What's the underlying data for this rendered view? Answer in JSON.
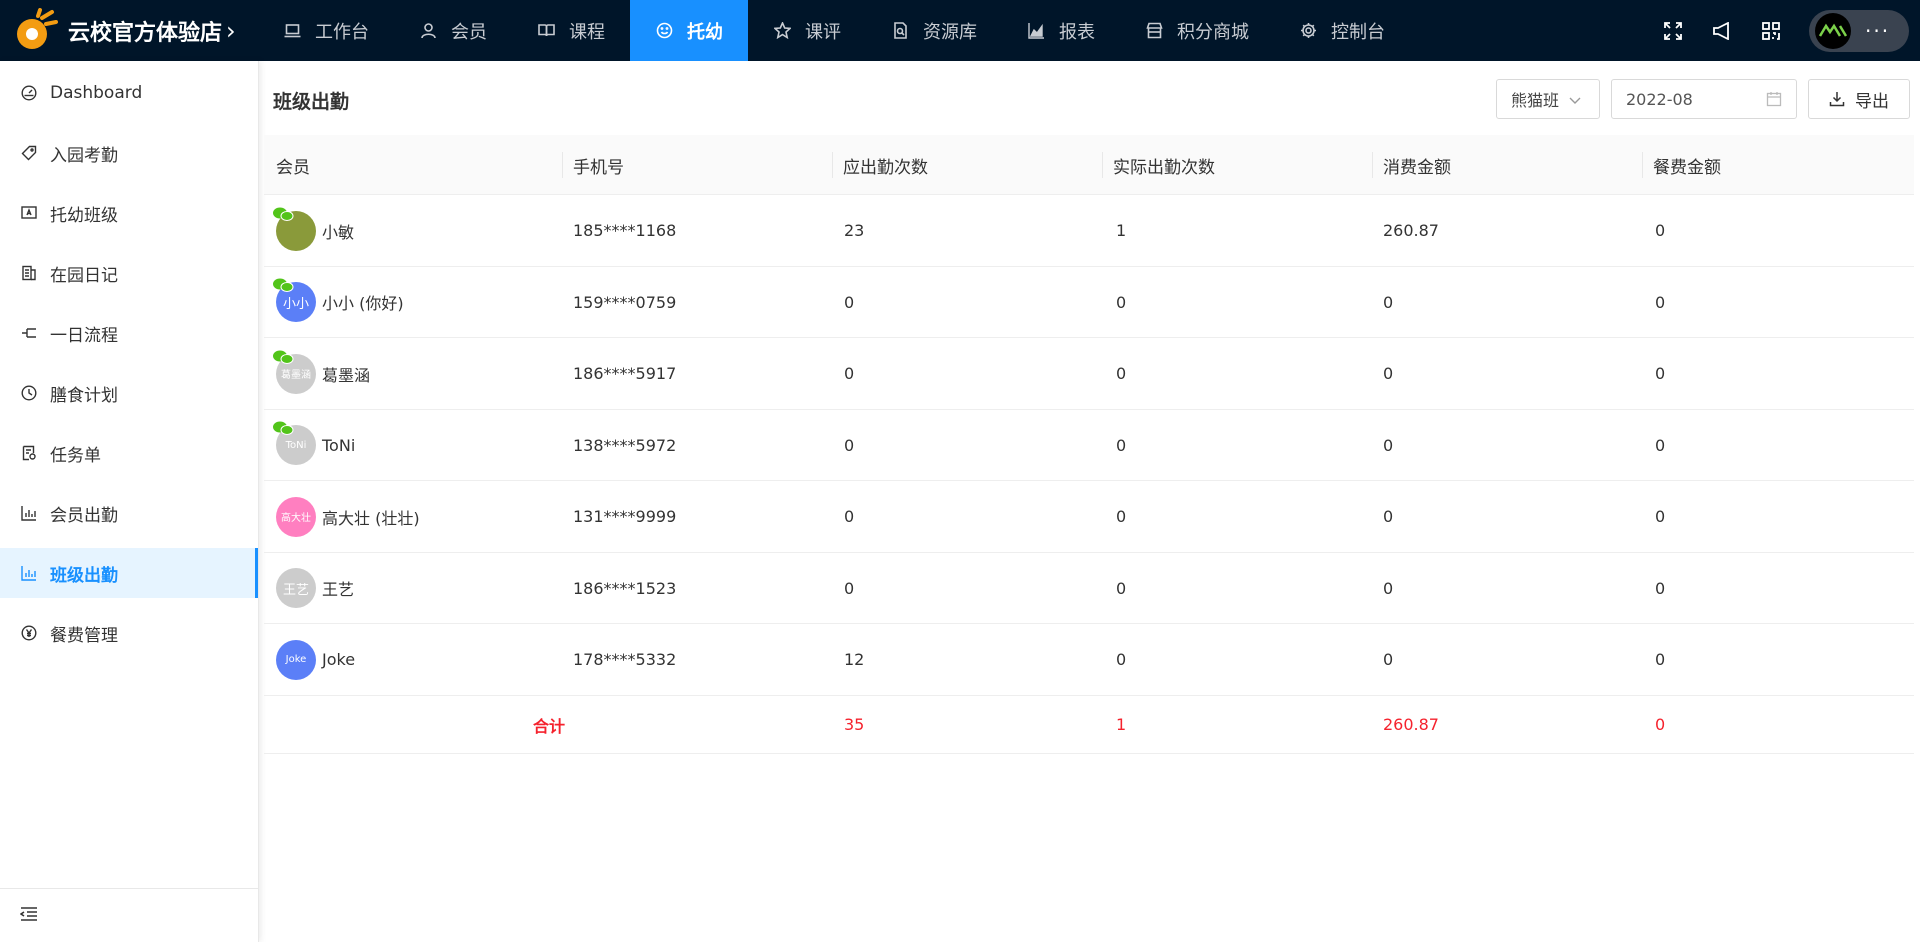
{
  "brand": {
    "title": "云校官方体验店"
  },
  "nav": [
    {
      "label": "工作台",
      "icon": "laptop-icon"
    },
    {
      "label": "会员",
      "icon": "user-icon"
    },
    {
      "label": "课程",
      "icon": "book-icon"
    },
    {
      "label": "托幼",
      "icon": "smile-icon",
      "active": true
    },
    {
      "label": "课评",
      "icon": "star-icon"
    },
    {
      "label": "资源库",
      "icon": "file-search-icon"
    },
    {
      "label": "报表",
      "icon": "area-chart-icon"
    },
    {
      "label": "积分商城",
      "icon": "shop-icon"
    },
    {
      "label": "控制台",
      "icon": "gear-icon"
    }
  ],
  "sidebar": {
    "items": [
      {
        "label": "Dashboard",
        "icon": "dashboard-icon"
      },
      {
        "label": "入园考勤",
        "icon": "tag-icon"
      },
      {
        "label": "托幼班级",
        "icon": "class-board-icon"
      },
      {
        "label": "在园日记",
        "icon": "diary-icon"
      },
      {
        "label": "一日流程",
        "icon": "flow-icon"
      },
      {
        "label": "膳食计划",
        "icon": "clock-icon"
      },
      {
        "label": "任务单",
        "icon": "task-list-icon"
      },
      {
        "label": "会员出勤",
        "icon": "bar-chart-icon"
      },
      {
        "label": "班级出勤",
        "icon": "bar-chart-icon",
        "active": true
      },
      {
        "label": "餐费管理",
        "icon": "yen-icon"
      }
    ]
  },
  "page": {
    "title": "班级出勤",
    "class_filter": "熊猫班",
    "date_filter": "2022-08",
    "export_label": "导出"
  },
  "table": {
    "columns": [
      "会员",
      "手机号",
      "应出勤次数",
      "实际出勤次数",
      "消费金额",
      "餐费金额"
    ],
    "rows": [
      {
        "name": "小敏",
        "avatar_text": "",
        "avatar_color": "#8a9a3a",
        "phone": "185****1168",
        "expected": "23",
        "actual": "1",
        "spend": "260.87",
        "meal": "0"
      },
      {
        "name": "小小 (你好)",
        "avatar_text": "小小",
        "avatar_color": "#5b7ff7",
        "phone": "159****0759",
        "expected": "0",
        "actual": "0",
        "spend": "0",
        "meal": "0"
      },
      {
        "name": "葛墨涵",
        "avatar_text": "葛墨涵",
        "avatar_color": "#cccccc",
        "phone": "186****5917",
        "expected": "0",
        "actual": "0",
        "spend": "0",
        "meal": "0"
      },
      {
        "name": "ToNi",
        "avatar_text": "ToNi",
        "avatar_color": "#cccccc",
        "phone": "138****5972",
        "expected": "0",
        "actual": "0",
        "spend": "0",
        "meal": "0"
      },
      {
        "name": "高大壮 (壮壮)",
        "avatar_text": "高大壮",
        "avatar_color": "#ff7fc0",
        "phone": "131****9999",
        "expected": "0",
        "actual": "0",
        "spend": "0",
        "meal": "0"
      },
      {
        "name": "王艺",
        "avatar_text": "王艺",
        "avatar_color": "#cccccc",
        "phone": "186****1523",
        "expected": "0",
        "actual": "0",
        "spend": "0",
        "meal": "0"
      },
      {
        "name": "Joke",
        "avatar_text": "Joke",
        "avatar_color": "#5b7ff7",
        "phone": "178****5332",
        "expected": "12",
        "actual": "0",
        "spend": "0",
        "meal": "0"
      }
    ],
    "total": {
      "label": "合计",
      "expected": "35",
      "actual": "1",
      "spend": "260.87",
      "meal": "0"
    }
  },
  "colors": {
    "topbar": "#001529",
    "accent": "#1890ff",
    "total": "#f5222d"
  }
}
